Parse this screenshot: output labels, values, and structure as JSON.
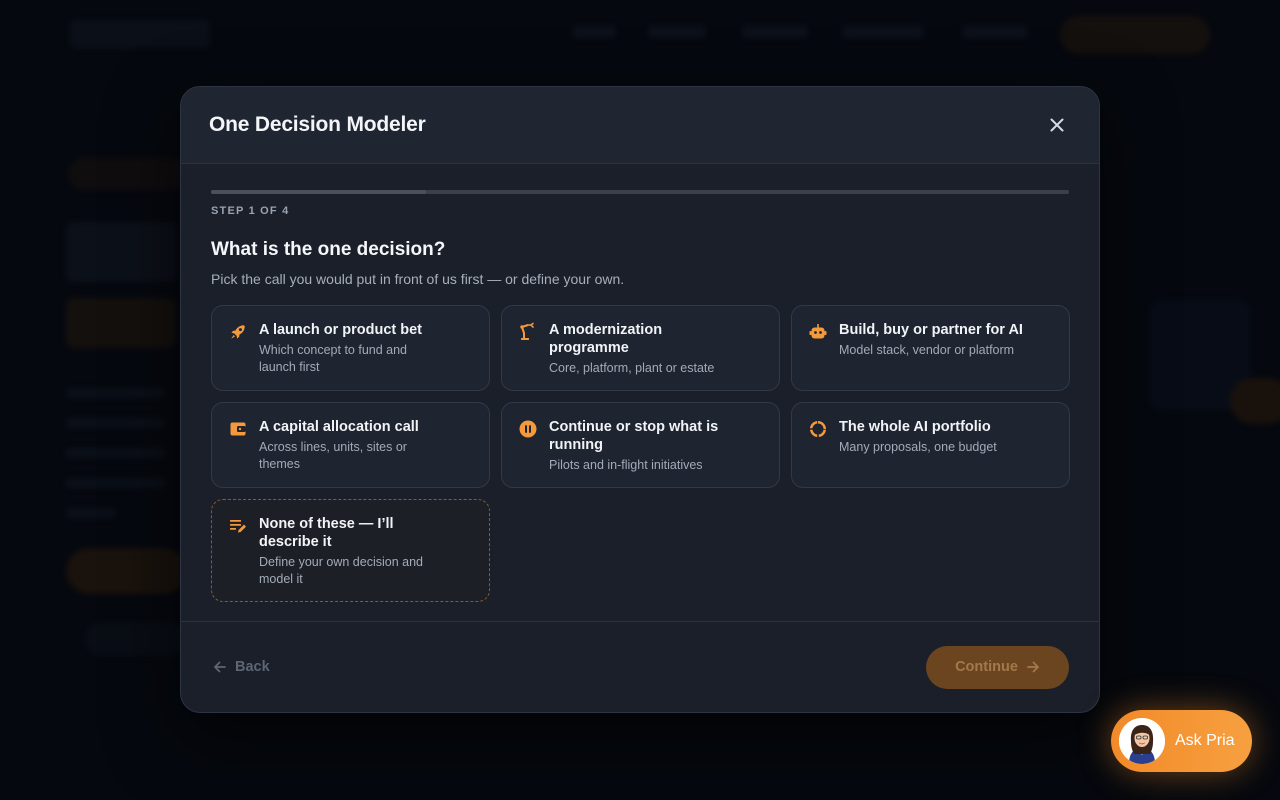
{
  "modal": {
    "title": "One Decision Modeler",
    "step_label": "STEP 1 OF 4",
    "progress_fraction": 0.25,
    "question": "What is the one decision?",
    "question_sub": "Pick the call you would put in front of us first — or define your own.",
    "options": [
      {
        "title": "A launch or product bet",
        "desc": "Which concept to fund and launch first",
        "icon": "rocket-icon"
      },
      {
        "title": "A modernization programme",
        "desc": "Core, platform, plant or estate",
        "icon": "robot-arm-icon"
      },
      {
        "title": "Build, buy or partner for AI",
        "desc": "Model stack, vendor or platform",
        "icon": "robot-icon"
      },
      {
        "title": "A capital allocation call",
        "desc": "Across lines, units, sites or themes",
        "icon": "wallet-icon"
      },
      {
        "title": "Continue or stop what is running",
        "desc": "Pilots and in-flight initiatives",
        "icon": "pause-icon"
      },
      {
        "title": "The whole AI portfolio",
        "desc": "Many proposals, one budget",
        "icon": "portfolio-ring-icon"
      },
      {
        "title": "None of these — I’ll describe it",
        "desc": "Define your own decision and model it",
        "icon": "edit-notes-icon"
      }
    ],
    "back_label": "Back",
    "continue_label": "Continue"
  },
  "assistant": {
    "label": "Ask Pria"
  },
  "colors": {
    "accent": "#f28a28",
    "modal_bg": "#1a1f29",
    "page_bg": "#060a12"
  }
}
